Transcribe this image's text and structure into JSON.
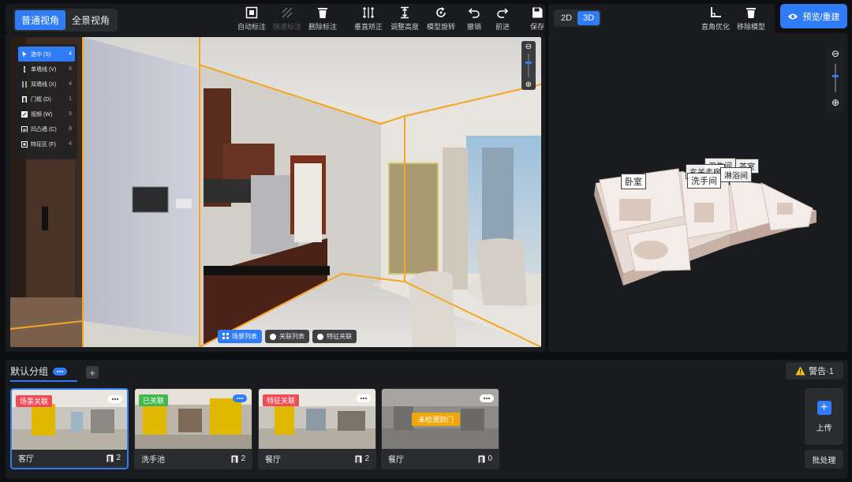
{
  "view_tabs": [
    {
      "label": "普通视角",
      "active": true
    },
    {
      "label": "全景视角",
      "active": false
    }
  ],
  "toolbar": {
    "auto_mark": "自动标注",
    "quick_mark": "快速标注",
    "delete_mark": "删除标注",
    "vertical_correct": "垂直矫正",
    "adjust_height": "调整高度",
    "model_rotate": "模型旋转",
    "undo": "撤销",
    "redo": "前进",
    "save": "保存"
  },
  "dim_tabs": [
    {
      "label": "2D",
      "active": false
    },
    {
      "label": "3D",
      "active": true
    }
  ],
  "model_tools": {
    "right_angle": "直角优化",
    "remove_model": "移除模型"
  },
  "preview_button": "预览/重建",
  "mode_menu": [
    {
      "label": "选中 (S)",
      "count": "4",
      "icon": "cursor-icon",
      "active": true
    },
    {
      "label": "单墙线 (V)",
      "count": "6",
      "icon": "single-wall-icon"
    },
    {
      "label": "双墙线 (X)",
      "count": "4",
      "icon": "double-wall-icon"
    },
    {
      "label": "门框 (D)",
      "count": "1",
      "icon": "door-frame-icon"
    },
    {
      "label": "视频 (W)",
      "count": "5",
      "icon": "video-icon"
    },
    {
      "label": "凹凸墙 (C)",
      "count": "8",
      "icon": "bump-wall-icon"
    },
    {
      "label": "特征区 (F)",
      "count": "4",
      "icon": "feature-area-icon"
    }
  ],
  "scene_tabs": [
    {
      "label": "场景列表",
      "active": true
    },
    {
      "label": "关联列表",
      "active": false
    },
    {
      "label": "特征关联",
      "active": false
    }
  ],
  "room_labels": [
    "卧室",
    "卫生间",
    "茶室",
    "玄关走廊",
    "淋浴间",
    "洗手间"
  ],
  "group": {
    "name": "默认分组"
  },
  "warning": "警告·1",
  "cards": [
    {
      "name": "客厅",
      "count": "2",
      "tag": "场景关联",
      "tag_color": "red",
      "selected": true
    },
    {
      "name": "洗手池",
      "count": "2",
      "tag": "已关联",
      "tag_color": "green",
      "selected": false
    },
    {
      "name": "餐厅",
      "count": "2",
      "tag": "特征关联",
      "tag_color": "red",
      "selected": false
    },
    {
      "name": "餐厅",
      "count": "0",
      "tag": "未检测到门",
      "tag_color": "orange",
      "selected": false
    }
  ],
  "upload_label": "上传",
  "batch_label": "批处理",
  "colors": {
    "accent": "#2f7cf6",
    "annotation_line": "#f5a623",
    "warning": "#f5c518"
  }
}
